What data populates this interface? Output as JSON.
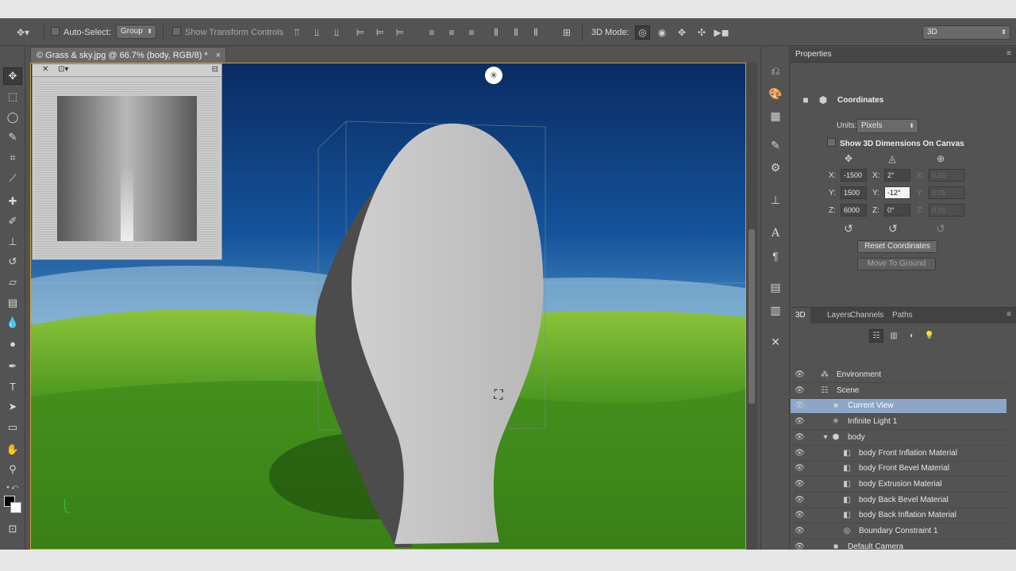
{
  "options_bar": {
    "auto_select_label": "Auto-Select:",
    "auto_select_value": "Group",
    "show_transform_label": "Show Transform Controls",
    "mode_label": "3D Mode:",
    "workspace_value": "3D"
  },
  "document": {
    "tab_title": "© Grass & sky.jpg @ 66.7% (body, RGB/8) *",
    "close_glyph": "×"
  },
  "properties": {
    "panel_title": "Properties",
    "section_title": "Coordinates",
    "units_label": "Units:",
    "units_value": "Pixels",
    "show_dimensions_label": "Show 3D Dimensions On Canvas",
    "position": {
      "x": "-1500",
      "y": "1500",
      "z": "6000"
    },
    "rotation": {
      "x": "2°",
      "y": "-12°",
      "z": "0°"
    },
    "scale": {
      "x": "0.01",
      "y": "0.01",
      "z": "0.01"
    },
    "axis_labels": {
      "x": "X:",
      "y": "Y:",
      "z": "Z:"
    },
    "reset_button": "Reset Coordinates",
    "move_button": "Move To Ground"
  },
  "layers_panel": {
    "tabs": [
      "3D",
      "Layers",
      "Channels",
      "Paths"
    ],
    "items": [
      {
        "label": "Environment",
        "icon": "environment-icon",
        "indent": 0,
        "selected": false
      },
      {
        "label": "Scene",
        "icon": "scene-icon",
        "indent": 0,
        "selected": false
      },
      {
        "label": "Current View",
        "icon": "camera-icon",
        "indent": 1,
        "selected": true
      },
      {
        "label": "Infinite Light 1",
        "icon": "light-icon",
        "indent": 1,
        "selected": false
      },
      {
        "label": "body",
        "icon": "mesh-icon",
        "indent": 1,
        "selected": false
      },
      {
        "label": "body Front Inflation Material",
        "icon": "material-icon",
        "indent": 2,
        "selected": false
      },
      {
        "label": "body Front Bevel Material",
        "icon": "material-icon",
        "indent": 2,
        "selected": false
      },
      {
        "label": "body Extrusion Material",
        "icon": "material-icon",
        "indent": 2,
        "selected": false
      },
      {
        "label": "body Back Bevel Material",
        "icon": "material-icon",
        "indent": 2,
        "selected": false
      },
      {
        "label": "body Back Inflation Material",
        "icon": "material-icon",
        "indent": 2,
        "selected": false
      },
      {
        "label": "Boundary Constraint 1",
        "icon": "constraint-icon",
        "indent": 2,
        "selected": false
      },
      {
        "label": "Default Camera",
        "icon": "camera-icon",
        "indent": 1,
        "selected": false
      }
    ]
  },
  "colors": {
    "accent_selected_row": "#8ca6c7",
    "canvas_border": "#c9a43a",
    "panel_bg": "#535353"
  }
}
